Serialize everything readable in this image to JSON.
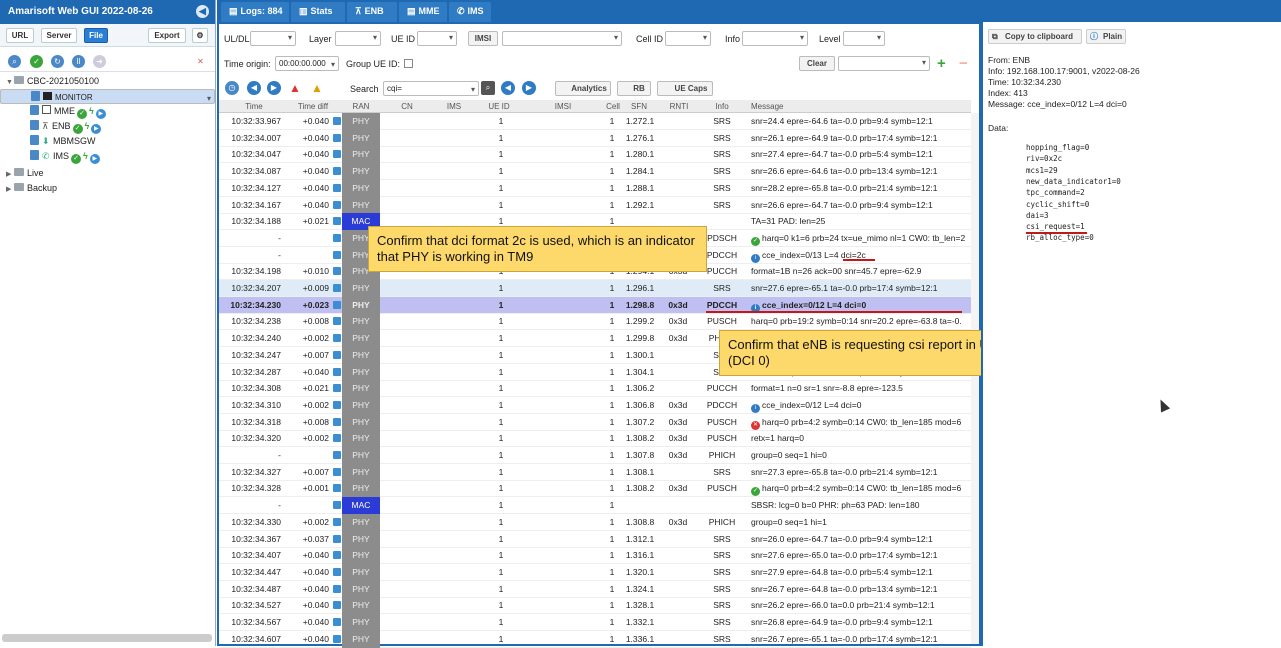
{
  "app": {
    "title": "Amarisoft Web GUI 2022-08-26"
  },
  "left": {
    "buttons": {
      "url": "URL",
      "server": "Server",
      "file": "File",
      "export": "Export"
    },
    "tree": {
      "root": "CBC-2021050100",
      "monitor": "MONITOR",
      "mme": "MME",
      "enb": "ENB",
      "mbmsgw": "MBMSGW",
      "ims": "IMS",
      "live": "Live",
      "backup": "Backup"
    }
  },
  "tabs": [
    {
      "label": "Logs: 884"
    },
    {
      "label": "Stats"
    },
    {
      "label": "ENB"
    },
    {
      "label": "MME"
    },
    {
      "label": "IMS"
    }
  ],
  "filters": {
    "uldl": "UL/DL",
    "layer": "Layer",
    "ueid": "UE ID",
    "imsi": "IMSI",
    "cellid": "Cell ID",
    "info": "Info",
    "level": "Level",
    "time_origin_label": "Time origin:",
    "time_origin_value": "00:00:00.000",
    "group_ue": "Group UE ID:",
    "clear": "Clear",
    "search_label": "Search",
    "search_value": "cqi=",
    "analytics": "Analytics",
    "rb": "RB",
    "uecaps": "UE Caps"
  },
  "columns": [
    "Time",
    "Time diff",
    "RAN",
    "CN",
    "IMS",
    "UE ID",
    "IMSI",
    "Cell",
    "SFN",
    "RNTI",
    "Info",
    "Message"
  ],
  "rows": [
    {
      "time": "10:32:33.967",
      "diff": "+0.040",
      "ran": "PHY",
      "ue": "1",
      "cell": "1",
      "sfn": "1.272.1",
      "rnti": "",
      "info": "SRS",
      "msg": "snr=24.4 epre=-64.6 ta=-0.0 prb=9:4 symb=12:1",
      "icon": ""
    },
    {
      "time": "10:32:34.007",
      "diff": "+0.040",
      "ran": "PHY",
      "ue": "1",
      "cell": "1",
      "sfn": "1.276.1",
      "rnti": "",
      "info": "SRS",
      "msg": "snr=26.1 epre=-64.9 ta=-0.0 prb=17:4 symb=12:1",
      "icon": ""
    },
    {
      "time": "10:32:34.047",
      "diff": "+0.040",
      "ran": "PHY",
      "ue": "1",
      "cell": "1",
      "sfn": "1.280.1",
      "rnti": "",
      "info": "SRS",
      "msg": "snr=27.4 epre=-64.7 ta=-0.0 prb=5:4 symb=12:1",
      "icon": ""
    },
    {
      "time": "10:32:34.087",
      "diff": "+0.040",
      "ran": "PHY",
      "ue": "1",
      "cell": "1",
      "sfn": "1.284.1",
      "rnti": "",
      "info": "SRS",
      "msg": "snr=26.6 epre=-64.6 ta=-0.0 prb=13:4 symb=12:1",
      "icon": ""
    },
    {
      "time": "10:32:34.127",
      "diff": "+0.040",
      "ran": "PHY",
      "ue": "1",
      "cell": "1",
      "sfn": "1.288.1",
      "rnti": "",
      "info": "SRS",
      "msg": "snr=28.2 epre=-65.8 ta=-0.0 prb=21:4 symb=12:1",
      "icon": ""
    },
    {
      "time": "10:32:34.167",
      "diff": "+0.040",
      "ran": "PHY",
      "ue": "1",
      "cell": "1",
      "sfn": "1.292.1",
      "rnti": "",
      "info": "SRS",
      "msg": "snr=26.6 epre=-64.7 ta=-0.0 prb=9:4 symb=12:1",
      "icon": ""
    },
    {
      "time": "10:32:34.188",
      "diff": "+0.021",
      "ran": "MAC",
      "ue": "1",
      "cell": "1",
      "sfn": "",
      "rnti": "",
      "info": "",
      "msg": "TA=31 PAD: len=25",
      "icon": ""
    },
    {
      "time": "-",
      "diff": "",
      "ran": "PHY",
      "ue": "1",
      "cell": "1",
      "sfn": "1.293.7",
      "rnti": "0x3d",
      "info": "PDSCH",
      "msg": "harq=0 k1=6 prb=24 tx=ue_mimo nl=1 CW0: tb_len=2",
      "icon": "ok"
    },
    {
      "time": "-",
      "diff": "",
      "ran": "PHY",
      "ue": "1",
      "cell": "1",
      "sfn": "1.293.7",
      "rnti": "0x3d",
      "info": "PDCCH",
      "msg": "cce_index=0/13 L=4 dci=2c",
      "icon": "info"
    },
    {
      "time": "10:32:34.198",
      "diff": "+0.010",
      "ran": "PHY",
      "ue": "1",
      "cell": "1",
      "sfn": "1.294.1",
      "rnti": "0x3d",
      "info": "PUCCH",
      "msg": "format=1B n=26 ack=00 snr=45.7 epre=-62.9",
      "icon": ""
    },
    {
      "time": "10:32:34.207",
      "diff": "+0.009",
      "ran": "PHY",
      "ue": "1",
      "cell": "1",
      "sfn": "1.296.1",
      "rnti": "",
      "info": "SRS",
      "msg": "snr=27.6 epre=-65.1 ta=-0.0 prb=17:4 symb=12:1",
      "icon": ""
    },
    {
      "time": "10:32:34.230",
      "diff": "+0.023",
      "ran": "PHY",
      "ue": "1",
      "cell": "1",
      "sfn": "1.298.8",
      "rnti": "0x3d",
      "info": "PDCCH",
      "msg": "cce_index=0/12 L=4 dci=0",
      "icon": "info"
    },
    {
      "time": "10:32:34.238",
      "diff": "+0.008",
      "ran": "PHY",
      "ue": "1",
      "cell": "1",
      "sfn": "1.299.2",
      "rnti": "0x3d",
      "info": "PUSCH",
      "msg": "harq=0 prb=19:2 symb=0:14 snr=20.2 epre=-63.8 ta=-0.",
      "icon": ""
    },
    {
      "time": "10:32:34.240",
      "diff": "+0.002",
      "ran": "PHY",
      "ue": "1",
      "cell": "1",
      "sfn": "1.299.8",
      "rnti": "0x3d",
      "info": "PHICH",
      "msg": "group=0 seq=1 hi=1",
      "icon": ""
    },
    {
      "time": "10:32:34.247",
      "diff": "+0.007",
      "ran": "PHY",
      "ue": "1",
      "cell": "1",
      "sfn": "1.300.1",
      "rnti": "",
      "info": "SRS",
      "msg": "snr=27.4 epre=-64.9 ta=-0.0 prb=5:4 symb=12:1",
      "icon": ""
    },
    {
      "time": "10:32:34.287",
      "diff": "+0.040",
      "ran": "PHY",
      "ue": "1",
      "cell": "1",
      "sfn": "1.304.1",
      "rnti": "",
      "info": "SRS",
      "msg": "snr=26.9 epre=-64.8 ta=-0.0 prb=13:4 symb=12:1",
      "icon": ""
    },
    {
      "time": "10:32:34.308",
      "diff": "+0.021",
      "ran": "PHY",
      "ue": "1",
      "cell": "1",
      "sfn": "1.306.2",
      "rnti": "",
      "info": "PUCCH",
      "msg": "format=1 n=0 sr=1 snr=-8.8 epre=-123.5",
      "icon": ""
    },
    {
      "time": "10:32:34.310",
      "diff": "+0.002",
      "ran": "PHY",
      "ue": "1",
      "cell": "1",
      "sfn": "1.306.8",
      "rnti": "0x3d",
      "info": "PDCCH",
      "msg": "cce_index=0/12 L=4 dci=0",
      "icon": "info"
    },
    {
      "time": "10:32:34.318",
      "diff": "+0.008",
      "ran": "PHY",
      "ue": "1",
      "cell": "1",
      "sfn": "1.307.2",
      "rnti": "0x3d",
      "info": "PUSCH",
      "msg": "harq=0 prb=4:2 symb=0:14 CW0: tb_len=185 mod=6",
      "icon": "err"
    },
    {
      "time": "10:32:34.320",
      "diff": "+0.002",
      "ran": "PHY",
      "ue": "1",
      "cell": "1",
      "sfn": "1.308.2",
      "rnti": "0x3d",
      "info": "PUSCH",
      "msg": "retx=1 harq=0",
      "icon": ""
    },
    {
      "time": "-",
      "diff": "",
      "ran": "PHY",
      "ue": "1",
      "cell": "1",
      "sfn": "1.307.8",
      "rnti": "0x3d",
      "info": "PHICH",
      "msg": "group=0 seq=1 hi=0",
      "icon": ""
    },
    {
      "time": "10:32:34.327",
      "diff": "+0.007",
      "ran": "PHY",
      "ue": "1",
      "cell": "1",
      "sfn": "1.308.1",
      "rnti": "",
      "info": "SRS",
      "msg": "snr=27.3 epre=-65.8 ta=-0.0 prb=21:4 symb=12:1",
      "icon": ""
    },
    {
      "time": "10:32:34.328",
      "diff": "+0.001",
      "ran": "PHY",
      "ue": "1",
      "cell": "1",
      "sfn": "1.308.2",
      "rnti": "0x3d",
      "info": "PUSCH",
      "msg": "harq=0 prb=4:2 symb=0:14 CW0: tb_len=185 mod=6",
      "icon": "ok"
    },
    {
      "time": "-",
      "diff": "",
      "ran": "MAC",
      "ue": "1",
      "cell": "1",
      "sfn": "",
      "rnti": "",
      "info": "",
      "msg": "SBSR: lcg=0 b=0 PHR: ph=63 PAD: len=180",
      "icon": ""
    },
    {
      "time": "10:32:34.330",
      "diff": "+0.002",
      "ran": "PHY",
      "ue": "1",
      "cell": "1",
      "sfn": "1.308.8",
      "rnti": "0x3d",
      "info": "PHICH",
      "msg": "group=0 seq=1 hi=1",
      "icon": ""
    },
    {
      "time": "10:32:34.367",
      "diff": "+0.037",
      "ran": "PHY",
      "ue": "1",
      "cell": "1",
      "sfn": "1.312.1",
      "rnti": "",
      "info": "SRS",
      "msg": "snr=26.0 epre=-64.7 ta=-0.0 prb=9:4 symb=12:1",
      "icon": ""
    },
    {
      "time": "10:32:34.407",
      "diff": "+0.040",
      "ran": "PHY",
      "ue": "1",
      "cell": "1",
      "sfn": "1.316.1",
      "rnti": "",
      "info": "SRS",
      "msg": "snr=27.6 epre=-65.0 ta=-0.0 prb=17:4 symb=12:1",
      "icon": ""
    },
    {
      "time": "10:32:34.447",
      "diff": "+0.040",
      "ran": "PHY",
      "ue": "1",
      "cell": "1",
      "sfn": "1.320.1",
      "rnti": "",
      "info": "SRS",
      "msg": "snr=27.9 epre=-64.8 ta=-0.0 prb=5:4 symb=12:1",
      "icon": ""
    },
    {
      "time": "10:32:34.487",
      "diff": "+0.040",
      "ran": "PHY",
      "ue": "1",
      "cell": "1",
      "sfn": "1.324.1",
      "rnti": "",
      "info": "SRS",
      "msg": "snr=26.7 epre=-64.8 ta=-0.0 prb=13:4 symb=12:1",
      "icon": ""
    },
    {
      "time": "10:32:34.527",
      "diff": "+0.040",
      "ran": "PHY",
      "ue": "1",
      "cell": "1",
      "sfn": "1.328.1",
      "rnti": "",
      "info": "SRS",
      "msg": "snr=26.2 epre=-66.0 ta=0.0 prb=21:4 symb=12:1",
      "icon": ""
    },
    {
      "time": "10:32:34.567",
      "diff": "+0.040",
      "ran": "PHY",
      "ue": "1",
      "cell": "1",
      "sfn": "1.332.1",
      "rnti": "",
      "info": "SRS",
      "msg": "snr=26.8 epre=-64.9 ta=-0.0 prb=9:4 symb=12:1",
      "icon": ""
    },
    {
      "time": "10:32:34.607",
      "diff": "+0.040",
      "ran": "PHY",
      "ue": "1",
      "cell": "1",
      "sfn": "1.336.1",
      "rnti": "",
      "info": "SRS",
      "msg": "snr=26.7 epre=-65.1 ta=-0.0 prb=17:4 symb=12:1",
      "icon": ""
    }
  ],
  "annotations": {
    "note1": "Confirm that dci format 2c is used, which is an indicator that PHY is working in TM9",
    "note2": "Confirm that eNB is requesting csi report in UL Grant (DCI 0)"
  },
  "details": {
    "copy": "Copy to clipboard",
    "plain": "Plain",
    "from": "From: ENB",
    "info": "Info: 192.168.100.17:9001, v2022-08-26",
    "time": "Time: 10:32:34.230",
    "index": "Index: 413",
    "message": "Message: cce_index=0/12 L=4 dci=0",
    "data_label": "Data:",
    "fields": [
      "hopping_flag=0",
      "riv=0x2c",
      "mcs1=29",
      "new_data_indicator1=0",
      "tpc_command=2",
      "cyclic_shift=0",
      "dai=3",
      "csi_request=1",
      "rb_alloc_type=0"
    ]
  },
  "colors": {
    "accent": "#1f69b3",
    "phy": "#8c8c8c",
    "mac": "#2b3bd6",
    "selected_row": "#bfbff2",
    "note": "#fdd86b",
    "underline": "#c41818"
  }
}
